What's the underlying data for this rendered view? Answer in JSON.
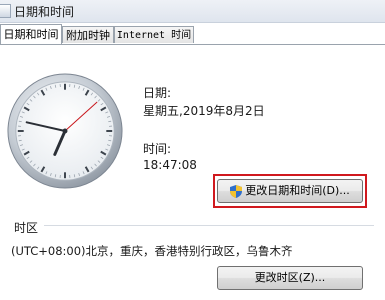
{
  "window": {
    "title": "日期和时间"
  },
  "tabs": [
    {
      "label": "日期和时间",
      "active": true
    },
    {
      "label": "附加时钟",
      "active": false
    },
    {
      "label": "Internet 时间",
      "active": false
    }
  ],
  "date_section": {
    "date_label": "日期:",
    "date_value": "星期五,2019年8月2日",
    "time_label": "时间:",
    "time_value": "18:47:08"
  },
  "clock": {
    "hour": 18,
    "minute": 47,
    "second": 8
  },
  "buttons": {
    "change_datetime": "更改日期和时间(D)...",
    "change_timezone": "更改时区(Z)..."
  },
  "timezone_section": {
    "heading": "时区",
    "value": "(UTC+08:00)北京，重庆，香港特别行政区，乌鲁木齐"
  },
  "colors": {
    "highlight_border": "#d0191e",
    "shield_blue": "#2f6fcb",
    "shield_yellow": "#f2c230"
  }
}
